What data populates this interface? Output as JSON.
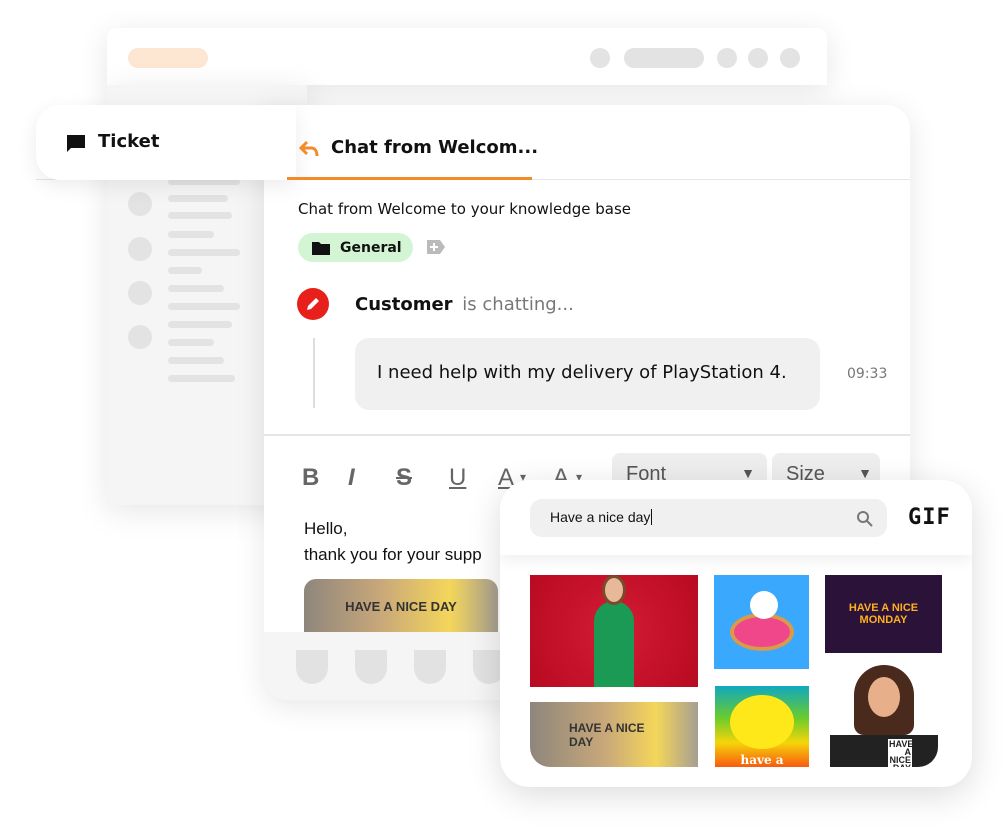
{
  "ticket_tab": {
    "label": "Ticket",
    "icon": "chat-bubble-icon"
  },
  "chat_tab": {
    "label": "Chat from Welcom...",
    "icon": "reply-icon",
    "accent": "#f28c28"
  },
  "chat": {
    "title": "Chat from Welcome to your knowledge base",
    "tag": "General",
    "customer_name": "Customer",
    "status": "is chatting...",
    "message": "I need help with my delivery of PlayStation 4.",
    "time": "09:33"
  },
  "toolbar": {
    "bold": "B",
    "italic": "I",
    "strike": "S",
    "underline": "U",
    "font_color": "A",
    "highlight": "A",
    "font_select": "Font",
    "size_select": "Size"
  },
  "editor": {
    "line1": "Hello,",
    "line2": "thank you for your supp",
    "image_text": "HAVE A NICE DAY"
  },
  "gif_picker": {
    "search_value": "Have a nice day",
    "brand": "GIF",
    "results": [
      "woman-smiling",
      "cat-donut",
      "HAVE A NICE MONDAY",
      "HAVE A NICE DAY",
      "have a",
      "HAVE A NICE DAY"
    ]
  }
}
